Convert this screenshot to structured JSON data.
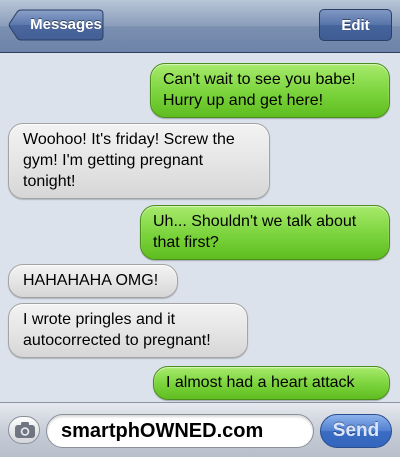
{
  "navbar": {
    "back_label": "Messages",
    "edit_label": "Edit"
  },
  "messages": [
    {
      "from": "sent",
      "text": "Can't wait to see you babe! Hurry up and get here!"
    },
    {
      "from": "received",
      "text": "Woohoo! It's friday! Screw the gym! I'm getting pregnant tonight!"
    },
    {
      "from": "sent",
      "text": "Uh... Shouldn't we talk about that first?"
    },
    {
      "from": "received",
      "text": "HAHAHAHA OMG!"
    },
    {
      "from": "received",
      "text": "I wrote pringles and it autocorrected to pregnant!"
    },
    {
      "from": "sent",
      "text": "I almost had a heart attack"
    }
  ],
  "composer": {
    "input_value": "smartphOWNED.com",
    "send_label": "Send",
    "camera_icon": "camera-icon"
  },
  "colors": {
    "sent_bubble": "#7ad33b",
    "received_bubble": "#e4e4e4",
    "thread_background": "#dbe2ec",
    "nav_blue": "#6d83a8"
  }
}
